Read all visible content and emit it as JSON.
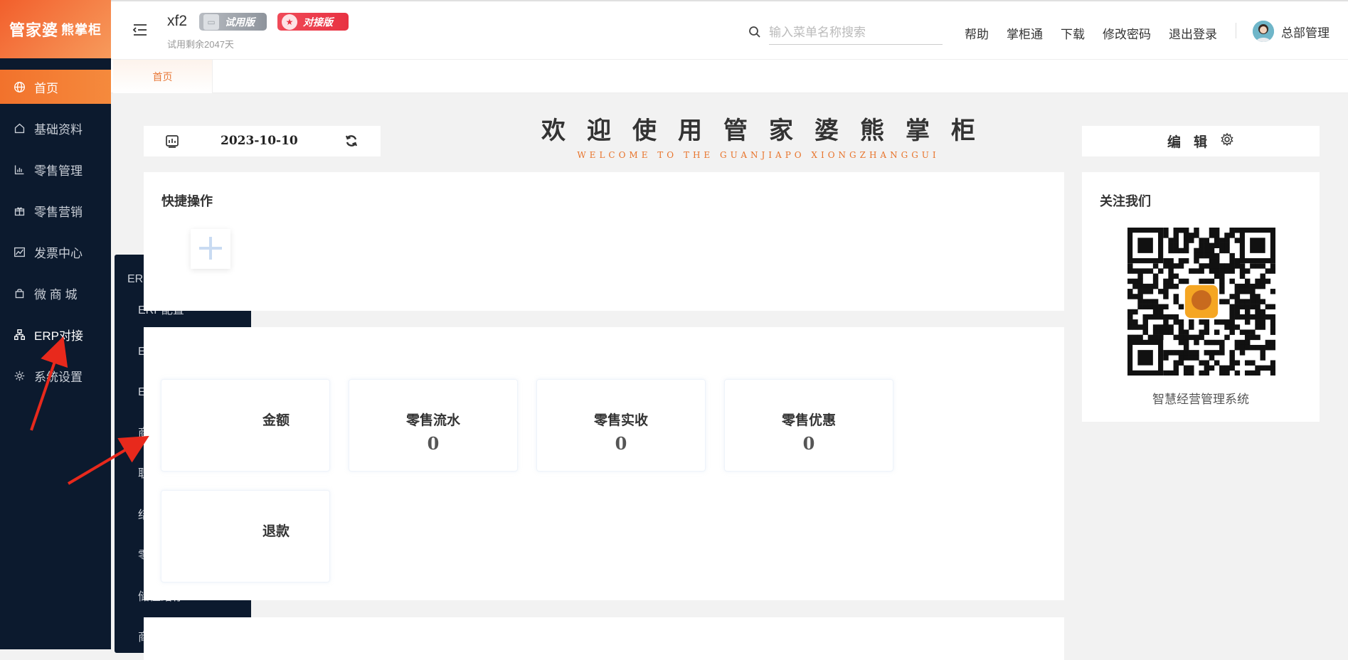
{
  "logo": {
    "text": "管家婆",
    "sub": "熊掌柜"
  },
  "sidebar": {
    "items": [
      {
        "label": "首页",
        "icon": "globe-icon"
      },
      {
        "label": "基础资料",
        "icon": "home-icon"
      },
      {
        "label": "零售管理",
        "icon": "bar-chart-icon"
      },
      {
        "label": "零售营销",
        "icon": "gift-icon"
      },
      {
        "label": "发票中心",
        "icon": "line-chart-icon"
      },
      {
        "label": "微 商 城",
        "icon": "bag-icon"
      },
      {
        "label": "ERP对接",
        "icon": "sitemap-icon"
      },
      {
        "label": "系统设置",
        "icon": "gear-icon"
      }
    ]
  },
  "flyout": {
    "title": "ERP信息设置",
    "items": [
      "ERP配置",
      "ERP信息同步",
      "ERP门店配置",
      "商品关联配置",
      "职员关联配置",
      "结存设置",
      "零售结存",
      "储值结存",
      "商城结存"
    ]
  },
  "header": {
    "app_name": "xf2",
    "badge_trial": "试用版",
    "badge_connect": "对接版",
    "trial_remaining": "试用剩余2047天",
    "search_placeholder": "输入菜单名称搜索",
    "links": [
      "帮助",
      "掌柜通",
      "下载",
      "修改密码",
      "退出登录"
    ],
    "user_name": "总部管理"
  },
  "tabs": [
    {
      "label": "首页"
    }
  ],
  "main": {
    "date": "2023-10-10",
    "welcome_title": "欢迎使用管家婆熊掌柜",
    "welcome_subtitle": "WELCOME TO THE GUANJIAPO XIONGZHANGGUI",
    "edit_label": "编辑",
    "quick_title": "快捷操作",
    "stats": [
      {
        "label": "金额",
        "value": ""
      },
      {
        "label": "零售流水",
        "value": "0"
      },
      {
        "label": "零售实收",
        "value": "0"
      },
      {
        "label": "零售优惠",
        "value": "0"
      },
      {
        "label": "退款",
        "value": ""
      }
    ],
    "follow_title": "关注我们",
    "qr_caption": "智慧经营管理系统"
  },
  "colors": {
    "accent": "#f2722c",
    "sidebar_bg": "#0c1a2e",
    "arrow": "#e8291c"
  }
}
